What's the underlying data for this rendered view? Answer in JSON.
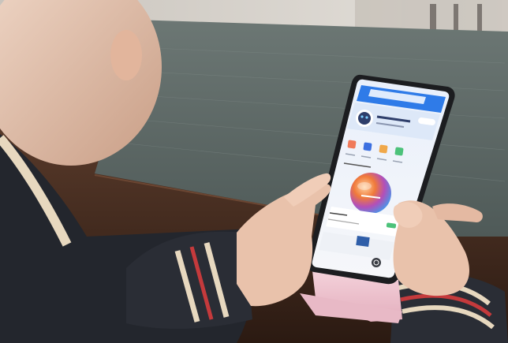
{
  "colors": {
    "wall": "#d9d5cf",
    "table_runner": "#5f6b68",
    "wood_table": "#4a2f22",
    "jacket": "#23262d",
    "jacket_stripe_cream": "#e7d8bf",
    "jacket_stripe_red": "#c53a3c",
    "skin": "#e9c2ab",
    "phone_body": "#1c1d20",
    "stand_pink": "#f0c8d3",
    "app_blue": "#2f7be8",
    "orb_orange": "#f07a3a",
    "orb_purple": "#7a5bd7",
    "orb_blue": "#3aa0f0"
  },
  "icons": [
    "robot-mascot-icon",
    "service-grid-icon",
    "gradient-orb-icon",
    "home-button-icon"
  ]
}
